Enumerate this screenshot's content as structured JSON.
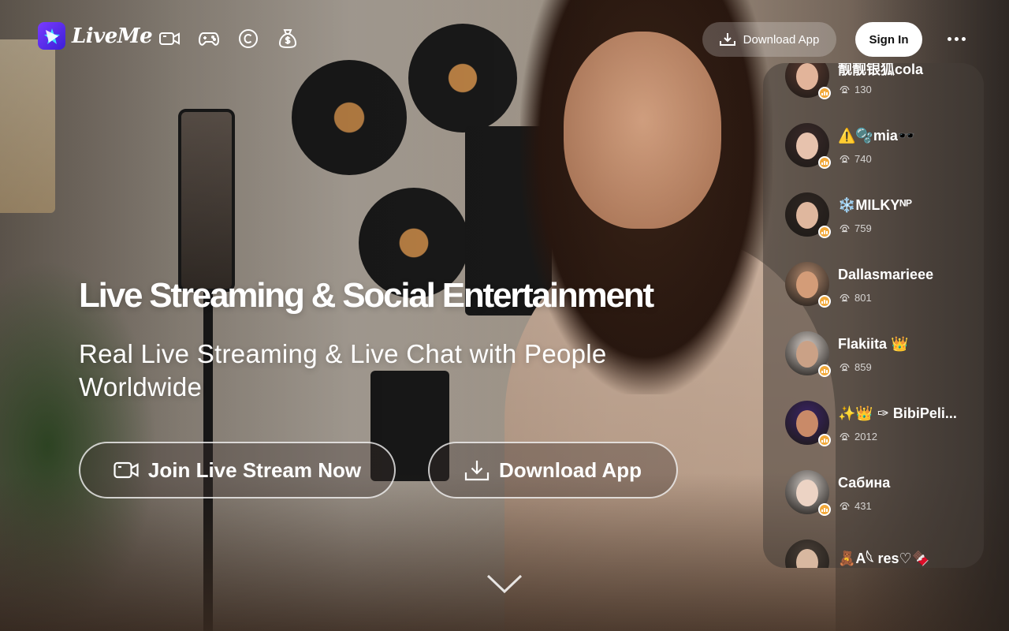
{
  "brand": {
    "name": "LiveMe"
  },
  "nav": [
    {
      "name": "live-video-nav-icon",
      "icon": "video-camera-icon"
    },
    {
      "name": "game-nav-icon",
      "icon": "gamepad-icon"
    },
    {
      "name": "coin-nav-icon",
      "icon": "copyright-coin-icon"
    },
    {
      "name": "money-bag-nav-icon",
      "icon": "money-bag-icon"
    }
  ],
  "header": {
    "download_label": "Download App",
    "signin_label": "Sign In"
  },
  "hero": {
    "title": "Live Streaming & Social Entertainment",
    "subtitle": "Real Live Streaming & Live Chat with People Worldwide",
    "join_label": "Join Live Stream Now",
    "download_label": "Download App"
  },
  "live_streams": [
    {
      "name": "靓靓银狐cola",
      "viewers": "130",
      "avatar_bg": "#5a3a30",
      "skin": "#e2b49a"
    },
    {
      "name": "⚠️🫧mia🕶️",
      "viewers": "740",
      "avatar_bg": "#3a2a2a",
      "skin": "#e7c2ad"
    },
    {
      "name": "❄️MILKYᴺᴾ",
      "viewers": "759",
      "avatar_bg": "#2f2723",
      "skin": "#dfb79e"
    },
    {
      "name": "Dallasmarieee",
      "viewers": "801",
      "avatar_bg": "#b38a6e",
      "skin": "#d39c78"
    },
    {
      "name": "Flakiita 👑",
      "viewers": "859",
      "avatar_bg": "#d9d2cc",
      "skin": "#caa186"
    },
    {
      "name": "✨👑 ✑ BibiPeli...",
      "viewers": "2012",
      "avatar_bg": "#3a2466",
      "skin": "#c98a68"
    },
    {
      "name": "Сабина",
      "viewers": "431",
      "avatar_bg": "#cfc9c4",
      "skin": "#ecd3c4"
    },
    {
      "name": "🧸A𓆩 res♡🍫",
      "viewers": "",
      "avatar_bg": "#4a4038",
      "skin": "#d8b8a0"
    }
  ],
  "colors": {
    "brand_gradient_start": "#7a3bff",
    "brand_gradient_end": "#3b1fd6",
    "live_badge": "#f2a93b",
    "signin_bg": "#ffffff"
  }
}
